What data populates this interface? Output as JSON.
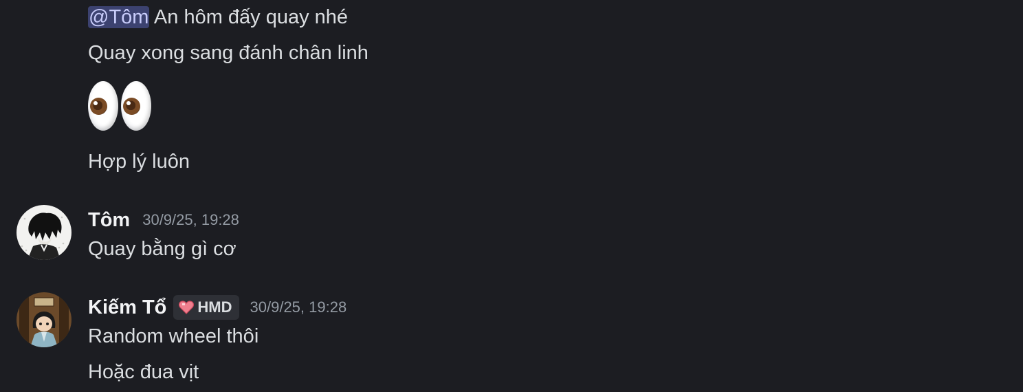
{
  "previous_message": {
    "mention": "@Tôm",
    "line1_text": " An hôm đấy quay nhé",
    "line2": "Quay xong sang đánh chân linh",
    "emoji": "eyes-emoji",
    "line4": "Hợp lý luôn"
  },
  "messages": [
    {
      "username": "Tôm",
      "timestamp": "30/9/25, 19:28",
      "avatar": "manga-character-avatar",
      "lines": [
        "Quay bằng gì cơ"
      ]
    },
    {
      "username": "Kiếm Tổ",
      "tag": {
        "icon": "heart-icon",
        "label": "HMD"
      },
      "timestamp": "30/9/25, 19:28",
      "avatar": "chibi-character-avatar",
      "lines": [
        "Random wheel thôi",
        "Hoặc đua vịt"
      ]
    }
  ],
  "colors": {
    "background": "#1c1d22",
    "text": "#dbdee1",
    "username": "#f2f3f5",
    "timestamp": "#949ba4",
    "mention_bg": "#3c4270",
    "mention_text": "#c9cdfb",
    "tag_bg": "#2e3036"
  }
}
